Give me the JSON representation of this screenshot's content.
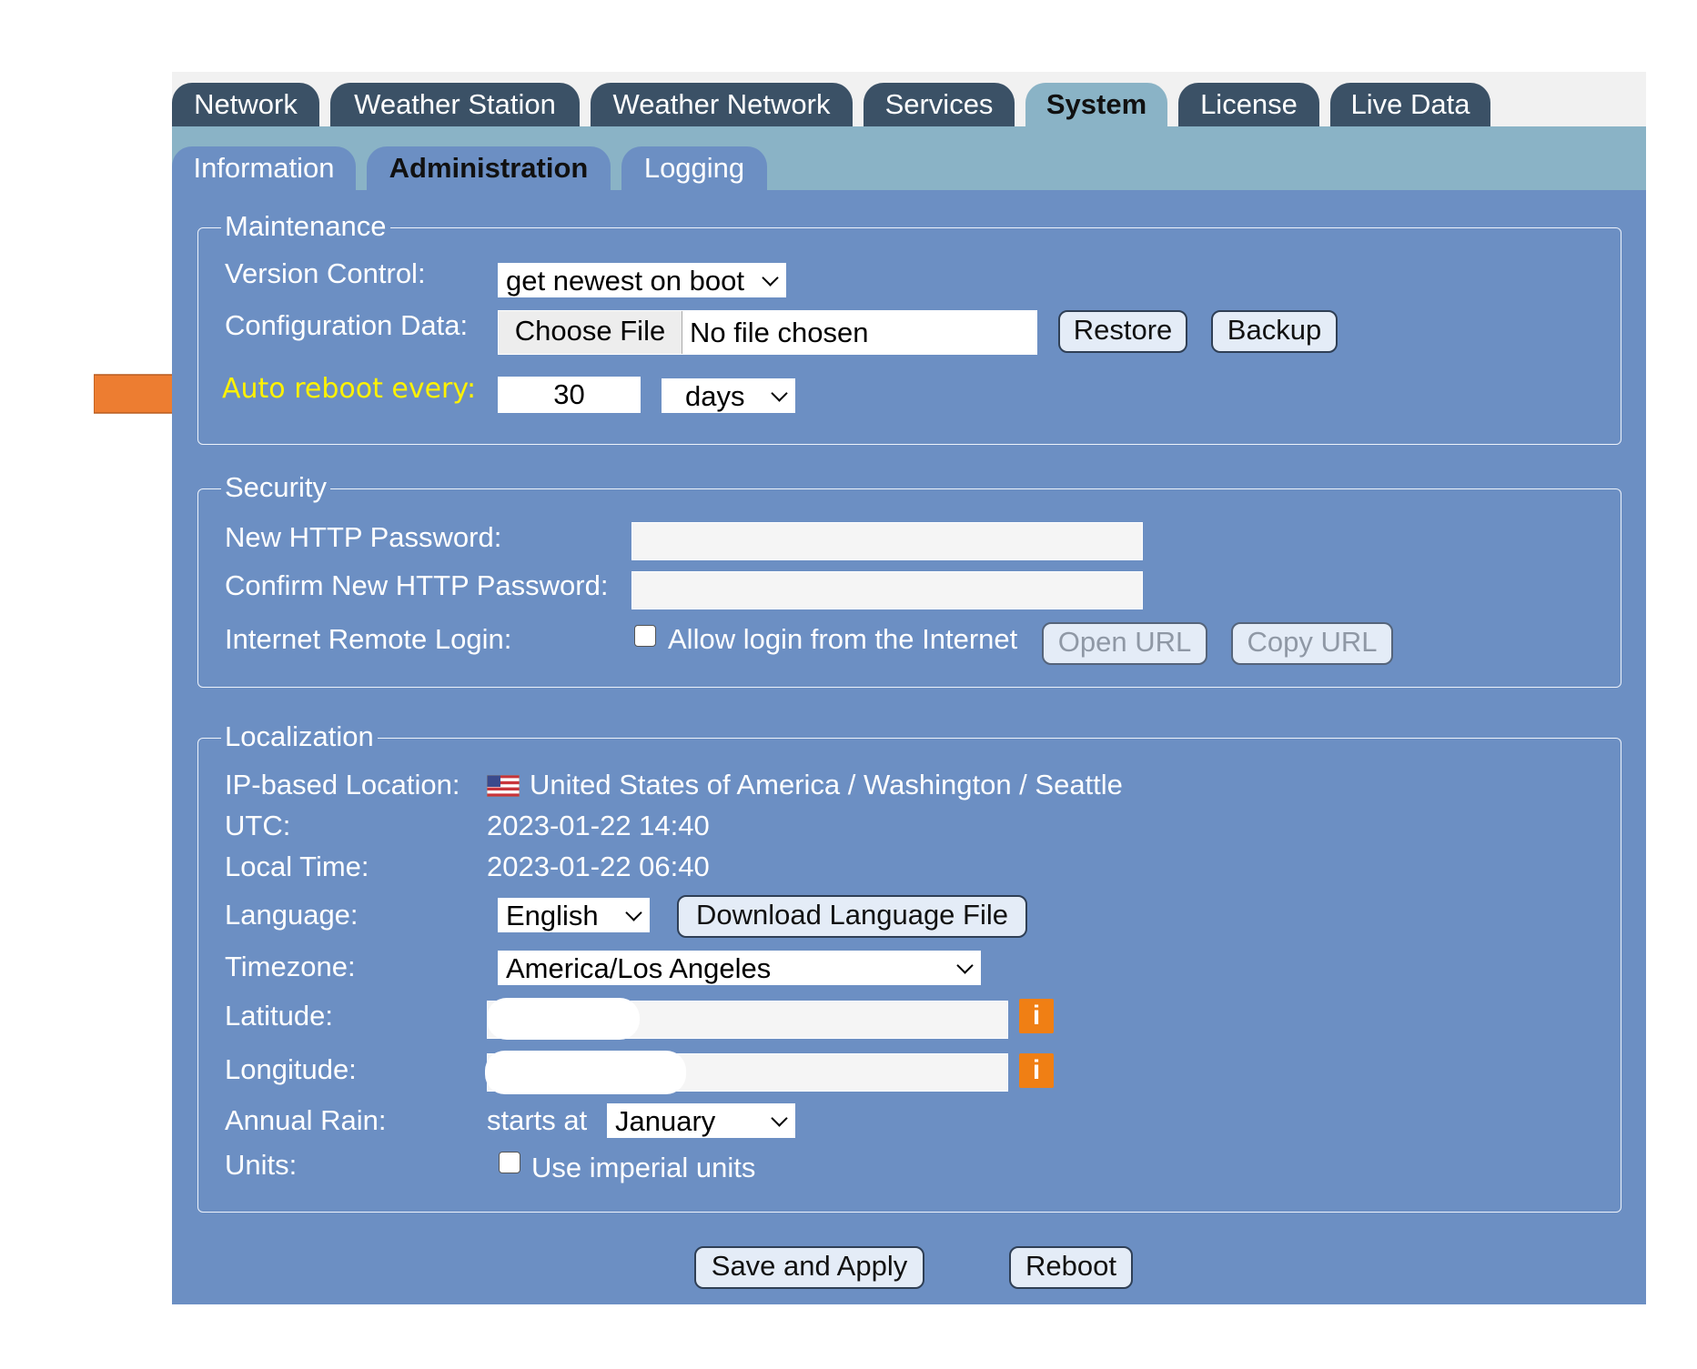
{
  "tabs": [
    "Network",
    "Weather Station",
    "Weather Network",
    "Services",
    "System",
    "License",
    "Live Data"
  ],
  "subtabs": [
    "Information",
    "Administration",
    "Logging"
  ],
  "maintenance": {
    "legend": "Maintenance",
    "version_label": "Version Control:",
    "version_value": "get newest on boot",
    "config_label": "Configuration Data:",
    "choose_file": "Choose File",
    "no_file": "No file chosen",
    "restore": "Restore",
    "backup": "Backup",
    "reboot_label": "Auto reboot every:",
    "reboot_value": "30",
    "reboot_unit": "days"
  },
  "security": {
    "legend": "Security",
    "new_pw_label": "New HTTP Password:",
    "confirm_pw_label": "Confirm New HTTP Password:",
    "remote_label": "Internet Remote Login:",
    "allow_label": "Allow login from the Internet",
    "open_url": "Open URL",
    "copy_url": "Copy URL"
  },
  "localization": {
    "legend": "Localization",
    "ip_label": "IP-based Location:",
    "ip_value": "United States of America / Washington / Seattle",
    "utc_label": "UTC:",
    "utc_value": "2023-01-22 14:40",
    "local_label": "Local Time:",
    "local_value": "2023-01-22 06:40",
    "language_label": "Language:",
    "language_value": "English",
    "download_lang": "Download Language File",
    "tz_label": "Timezone:",
    "tz_value": "America/Los Angeles",
    "lat_label": "Latitude:",
    "lon_label": "Longitude:",
    "info_glyph": "i",
    "rain_label": "Annual Rain:",
    "rain_prefix": "starts at",
    "rain_month": "January",
    "units_label": "Units:",
    "imperial_label": "Use imperial units"
  },
  "actions": {
    "save": "Save and Apply",
    "reboot": "Reboot"
  },
  "colors": {
    "panel": "#6c8fc3",
    "subbar": "#8ab3c6",
    "tab": "#3b5166",
    "highlight": "#fff200",
    "arrow": "#ed7d31",
    "info": "#f07f14"
  }
}
